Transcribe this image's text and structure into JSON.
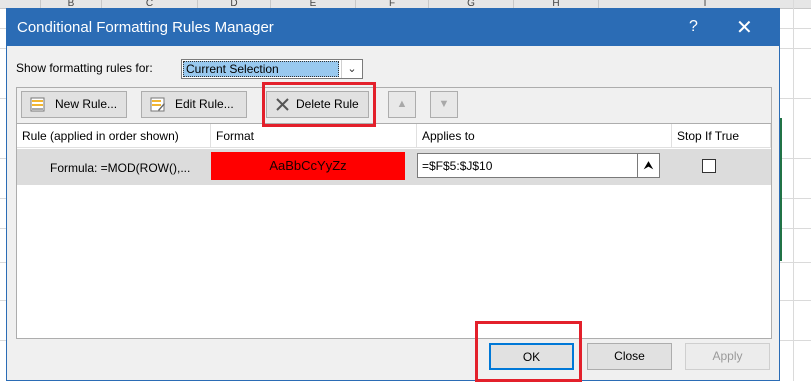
{
  "sheet": {
    "columns": [
      "B",
      "C",
      "D",
      "E",
      "F",
      "G",
      "H",
      "I"
    ]
  },
  "dialog": {
    "title": "Conditional Formatting Rules Manager",
    "help_glyph": "?",
    "close_glyph": "✕",
    "show_label": "Show formatting rules for:",
    "show_value": "Current Selection",
    "toolbar": {
      "new_rule": "New Rule...",
      "edit_rule": "Edit Rule...",
      "delete_rule": "Delete Rule",
      "move_up": "▲",
      "move_down": "▼"
    },
    "table": {
      "headers": [
        "Rule (applied in order shown)",
        "Format",
        "Applies to",
        "Stop If True"
      ],
      "rows": [
        {
          "rule": "Formula: =MOD(ROW(),...",
          "format_preview": "AaBbCcYyZz",
          "format_fill": "#ff0000",
          "applies_to": "=$F$5:$J$10",
          "stop_if_true": false
        }
      ]
    },
    "footer": {
      "ok": "OK",
      "close": "Close",
      "apply": "Apply"
    }
  },
  "colors": {
    "title_bar": "#2b6cb5",
    "highlight": "#e3202b",
    "selection": "#99c9ef"
  }
}
